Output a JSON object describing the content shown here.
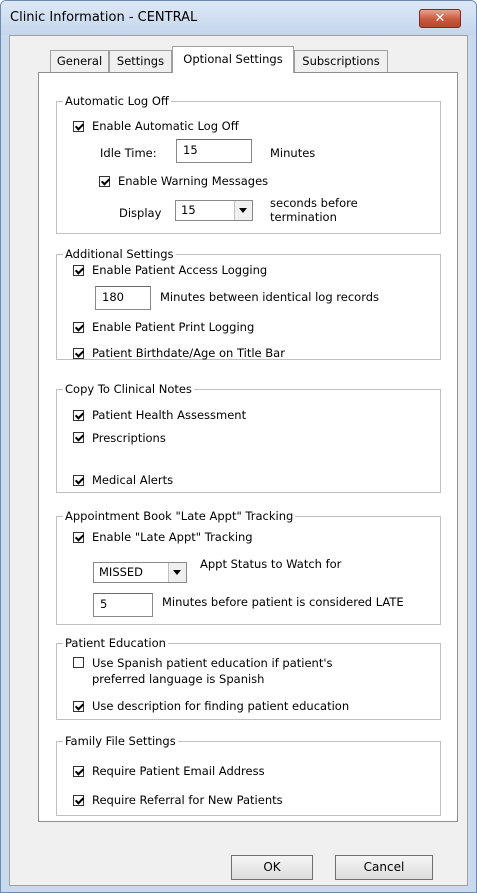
{
  "window": {
    "title": "Clinic Information - CENTRAL",
    "close_glyph": "✕"
  },
  "tabs": [
    "General",
    "Settings",
    "Optional Settings",
    "Subscriptions"
  ],
  "active_tab": "Optional Settings",
  "auto_logoff": {
    "group_label": "Automatic Log Off",
    "enable_label": "Enable Automatic Log Off",
    "enable_checked": true,
    "idle_label": "Idle Time:",
    "idle_value": "15",
    "idle_unit": "Minutes",
    "warning_label": "Enable Warning Messages",
    "warning_checked": true,
    "display_label": "Display",
    "display_value": "15",
    "display_suffix_line1": "seconds before",
    "display_suffix_line2": "termination"
  },
  "additional": {
    "group_label": "Additional Settings",
    "access_logging_label": "Enable Patient Access Logging",
    "access_logging_checked": true,
    "minutes_value": "180",
    "minutes_label": "Minutes between identical log records",
    "print_logging_label": "Enable Patient Print Logging",
    "print_logging_checked": true,
    "birthdate_label": "Patient Birthdate/Age on Title Bar",
    "birthdate_checked": true
  },
  "clinical_notes": {
    "group_label": "Copy To Clinical Notes",
    "health_label": "Patient Health Assessment",
    "health_checked": true,
    "prescriptions_label": "Prescriptions",
    "prescriptions_checked": true,
    "alerts_label": "Medical Alerts",
    "alerts_checked": true
  },
  "late_appt": {
    "group_label": "Appointment Book \"Late Appt\" Tracking",
    "enable_label": "Enable \"Late Appt\" Tracking",
    "enable_checked": true,
    "status_value": "MISSED",
    "status_label": "Appt Status to Watch for",
    "minutes_value": "5",
    "minutes_label": "Minutes before patient is considered LATE"
  },
  "education": {
    "group_label": "Patient Education",
    "spanish_line1": "Use Spanish patient education if patient's",
    "spanish_line2": "preferred language is Spanish",
    "spanish_checked": false,
    "description_label": "Use description for finding patient education",
    "description_checked": true
  },
  "family": {
    "group_label": "Family File Settings",
    "email_label": "Require Patient Email Address",
    "email_checked": true,
    "referral_label": "Require Referral for New Patients",
    "referral_checked": true
  },
  "buttons": {
    "ok": "OK",
    "cancel": "Cancel"
  },
  "colors": {
    "title_bar": "#c9daee",
    "close_button": "#c75a3e"
  }
}
